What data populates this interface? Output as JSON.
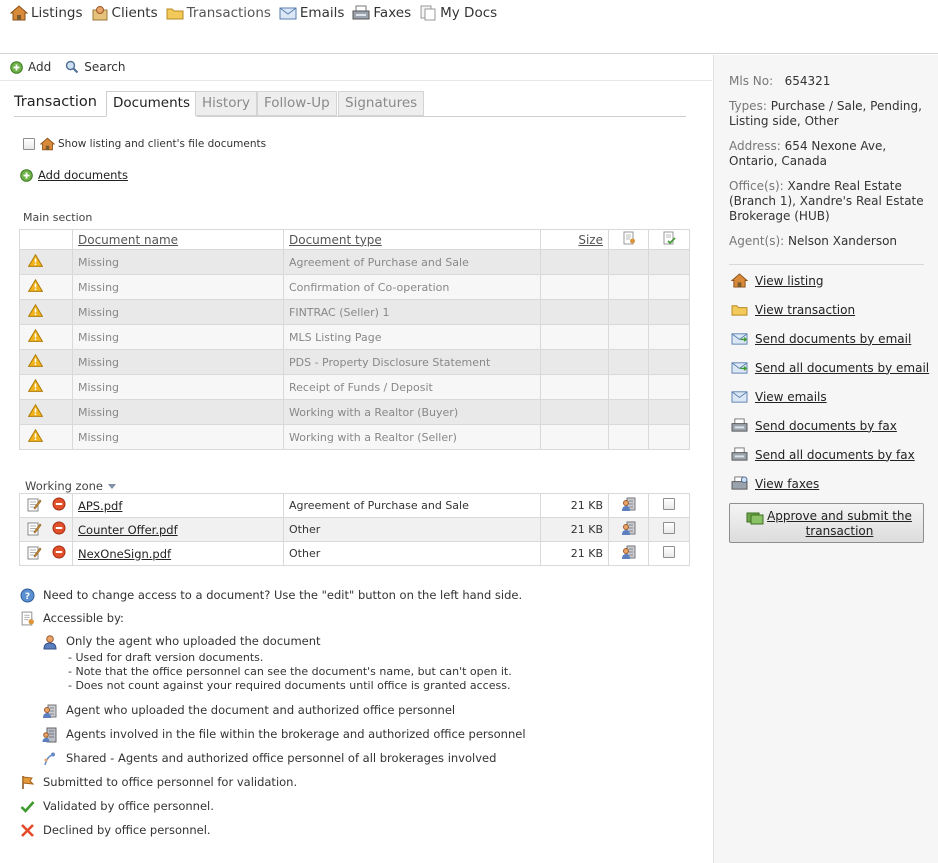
{
  "topnav": {
    "items": [
      {
        "label": "Listings",
        "icon": "house-icon"
      },
      {
        "label": "Clients",
        "icon": "clients-icon"
      },
      {
        "label": "Transactions",
        "icon": "folder-icon"
      },
      {
        "label": "Emails",
        "icon": "envelope-icon"
      },
      {
        "label": "Faxes",
        "icon": "fax-icon"
      },
      {
        "label": "My Docs",
        "icon": "docs-icon"
      }
    ]
  },
  "toolbar": {
    "add_label": "Add",
    "search_label": "Search"
  },
  "tabs": {
    "transaction": "Transaction",
    "documents": "Documents",
    "history": "History",
    "followup": "Follow-Up",
    "signatures": "Signatures"
  },
  "show_docs_label": "Show listing and client's file documents",
  "add_documents_label": "Add documents",
  "main_section": {
    "label": "Main section",
    "headers": {
      "name": "Document name",
      "type": "Document type",
      "size": "Size"
    },
    "rows": [
      {
        "name": "Missing",
        "type": "Agreement of Purchase and Sale"
      },
      {
        "name": "Missing",
        "type": "Confirmation of Co-operation"
      },
      {
        "name": "Missing",
        "type": "FINTRAC (Seller) 1"
      },
      {
        "name": "Missing",
        "type": "MLS Listing Page"
      },
      {
        "name": "Missing",
        "type": "PDS - Property Disclosure Statement"
      },
      {
        "name": "Missing",
        "type": "Receipt of Funds / Deposit"
      },
      {
        "name": "Missing",
        "type": "Working with a Realtor (Buyer)"
      },
      {
        "name": "Missing",
        "type": "Working with a Realtor (Seller)"
      }
    ]
  },
  "working_zone": {
    "label": "Working zone",
    "rows": [
      {
        "file": "APS.pdf",
        "type": "Agreement of Purchase and Sale",
        "size": "21 KB"
      },
      {
        "file": "Counter Offer.pdf",
        "type": "Other",
        "size": "21 KB"
      },
      {
        "file": "NexOneSign.pdf",
        "type": "Other",
        "size": "21 KB"
      }
    ]
  },
  "legend": {
    "help": "Need to change access to a document? Use the \"edit\" button on the left hand side.",
    "accessible_by": "Accessible by:",
    "only_agent": "Only the agent who uploaded the document",
    "only_agent_notes": [
      "- Used for draft version documents.",
      "- Note that the office personnel can see the document's name, but can't open it.",
      "- Does not count against your required documents until office is granted access."
    ],
    "agent_office": "Agent who uploaded the document and authorized office personnel",
    "agents_brokerage": "Agents involved in the file within the brokerage and authorized office personnel",
    "shared": "Shared - Agents and authorized office personnel of all brokerages involved",
    "submitted": "Submitted to office personnel for validation.",
    "validated": "Validated by office personnel.",
    "declined": "Declined by office personnel."
  },
  "sidebar": {
    "mls_label": "Mls No:",
    "mls_value": "654321",
    "types_label": "Types:",
    "types_value": "Purchase / Sale, Pending, Listing side, Other",
    "address_label": "Address:",
    "address_value": "654 Nexone Ave, Ontario, Canada",
    "offices_label": "Office(s):",
    "offices_value": "Xandre Real Estate (Branch 1), Xandre's Real Estate Brokerage (HUB)",
    "agents_label": "Agent(s):",
    "agents_value": "Nelson Xanderson",
    "links": {
      "view_listing": "View listing",
      "view_transaction": "View transaction",
      "send_docs_email": "Send documents by email",
      "send_all_email": "Send all documents by email",
      "view_emails": "View emails",
      "send_docs_fax": "Send documents by fax",
      "send_all_fax": "Send all documents by fax",
      "view_faxes": "View faxes"
    },
    "approve_label": "Approve and submit the transaction"
  },
  "colors": {
    "row_dark": "#e9e9e9",
    "row_light": "#f7f7f7",
    "sidebar_bg": "#f6f6f6",
    "warning": "#f0b31c",
    "remove": "#e0502a",
    "validated": "#3e9a2e",
    "declined": "#e34a2a"
  }
}
